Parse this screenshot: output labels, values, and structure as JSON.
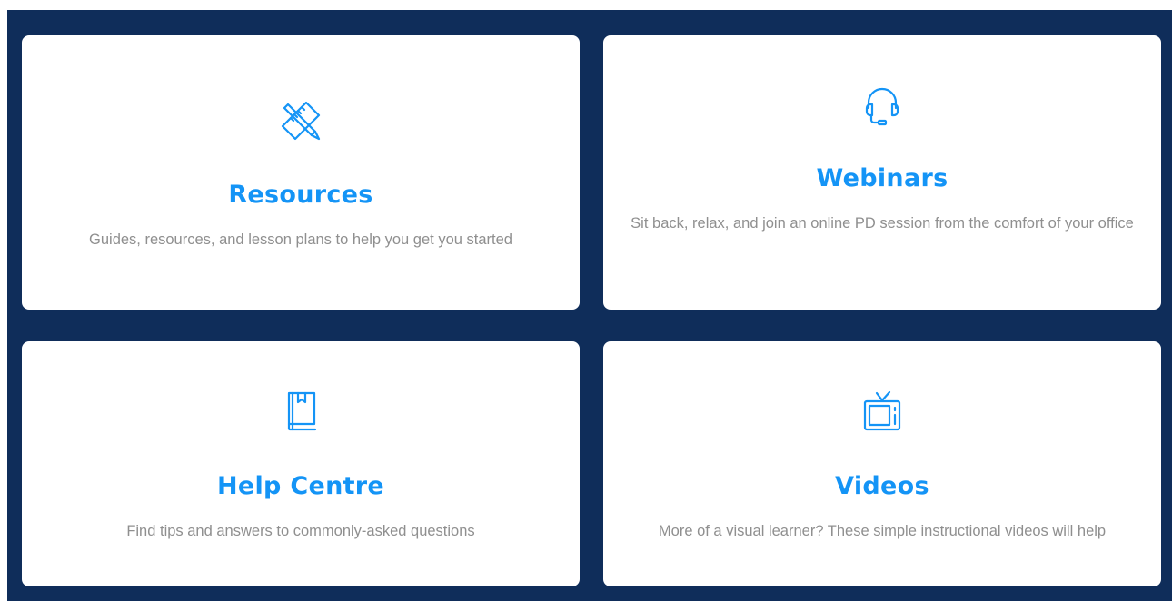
{
  "theme": {
    "background": "#0f2d5a",
    "card": "#ffffff",
    "accent": "#1494f6",
    "text_muted": "#8f8f8f"
  },
  "cards": [
    {
      "icon": "ruler-pencil-icon",
      "title": "Resources",
      "description": "Guides, resources, and lesson plans to help you get you started"
    },
    {
      "icon": "headset-icon",
      "title": "Webinars",
      "description": "Sit back, relax, and join an online PD session from the comfort of your office"
    },
    {
      "icon": "book-icon",
      "title": "Help Centre",
      "description": "Find tips and answers to commonly-asked questions"
    },
    {
      "icon": "tv-icon",
      "title": "Videos",
      "description": "More of a visual learner? These simple instructional videos will help"
    }
  ]
}
